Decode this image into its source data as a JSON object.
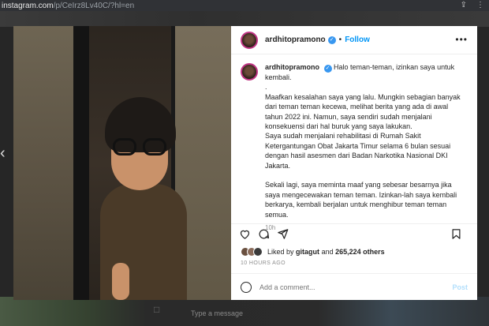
{
  "browser": {
    "url_host": "instagram.com",
    "url_path": "/p/CeIrz8Lv40C/?hl=en"
  },
  "post": {
    "username": "ardhitopramono",
    "follow_label": "Follow",
    "more_label": "•••",
    "caption_lines": [
      "Halo teman-teman, izinkan saya untuk",
      "kembali.",
      ".",
      "Maafkan kesalahan saya yang lalu. Mungkin sebagian banyak",
      "dari teman teman kecewa, melihat berita yang ada di awal",
      "tahun 2022 ini. Namun, saya sendiri sudah menjalani",
      "konsekuensi dari hal buruk yang saya lakukan.",
      "Saya sudah menjalani rehabilitasi di Rumah Sakit",
      "Ketergantungan Obat Jakarta Timur selama 6 bulan sesuai",
      "dengan hasil asesmen dari Badan Narkotika Nasional DKI",
      "Jakarta.",
      "",
      "Sekali lagi, saya meminta maaf yang sebesar besarnya jika",
      "saya mengecewakan teman teman. Izinkan-lah saya kembali",
      "berkarya, kembali berjalan untuk menghibur teman teman",
      "semua."
    ],
    "caption_time": "10h",
    "liked_by_prefix": "Liked by",
    "liked_by_user": "gitagut",
    "liked_by_and": "and",
    "likes_count": "265,224 others",
    "posted_ago": "10 HOURS AGO",
    "comment_placeholder": "Add a comment...",
    "post_button": "Post"
  },
  "background": {
    "message_placeholder": "Type a message"
  },
  "icons": {
    "verified": "verified-badge-icon",
    "like": "heart-icon",
    "comment": "comment-icon",
    "share": "share-icon",
    "save": "bookmark-icon",
    "emoji": "emoji-icon",
    "back": "chevron-left-icon"
  },
  "colors": {
    "accent": "#0095f6",
    "verified": "#3897f0",
    "post_disabled": "#b2dffc"
  }
}
